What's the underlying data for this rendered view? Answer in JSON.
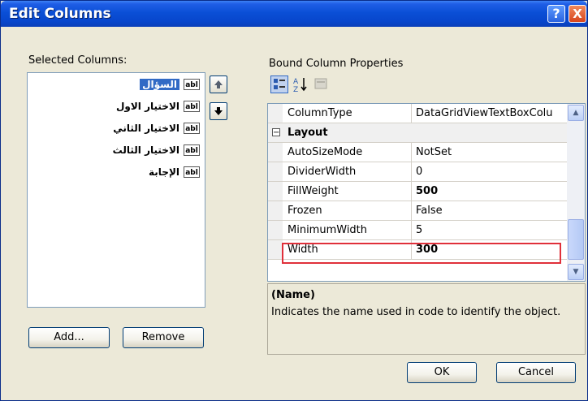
{
  "window": {
    "title": "Edit Columns"
  },
  "title_buttons": {
    "help": "?",
    "close": "X"
  },
  "left": {
    "label": "Selected Columns:",
    "items": [
      {
        "text": "السؤال",
        "icon": "abl",
        "selected": true
      },
      {
        "text": "الاختيار الاول",
        "icon": "abl",
        "selected": false
      },
      {
        "text": "الاختيار الثاني",
        "icon": "abl",
        "selected": false
      },
      {
        "text": "الاختيار الثالث",
        "icon": "abl",
        "selected": false
      },
      {
        "text": "الإجابة",
        "icon": "abl",
        "selected": false
      }
    ],
    "add_button": "Add...",
    "remove_button": "Remove"
  },
  "right": {
    "label": "Bound Column Properties",
    "toolbar": {
      "categorized": "categorized-icon",
      "alphabetical": "sort-az-icon",
      "pages": "property-pages-icon"
    },
    "rows": [
      {
        "name": "ColumnType",
        "value": "DataGridViewTextBoxColu",
        "bold": false
      },
      {
        "category": "Layout",
        "toggle": "⊟"
      },
      {
        "name": "AutoSizeMode",
        "value": "NotSet",
        "bold": false
      },
      {
        "name": "DividerWidth",
        "value": "0",
        "bold": false
      },
      {
        "name": "FillWeight",
        "value": "500",
        "bold": true
      },
      {
        "name": "Frozen",
        "value": "False",
        "bold": false
      },
      {
        "name": "MinimumWidth",
        "value": "5",
        "bold": false
      },
      {
        "name": "Width",
        "value": "300",
        "bold": true
      }
    ],
    "description": {
      "title": "(Name)",
      "text": "Indicates the name used in code to identify the object."
    }
  },
  "footer": {
    "ok": "OK",
    "cancel": "Cancel"
  },
  "colors": {
    "title_bar": "#0a4fd6",
    "selection": "#316ac5",
    "highlight_box": "#e0303a",
    "dialog_bg": "#ece9d8"
  }
}
